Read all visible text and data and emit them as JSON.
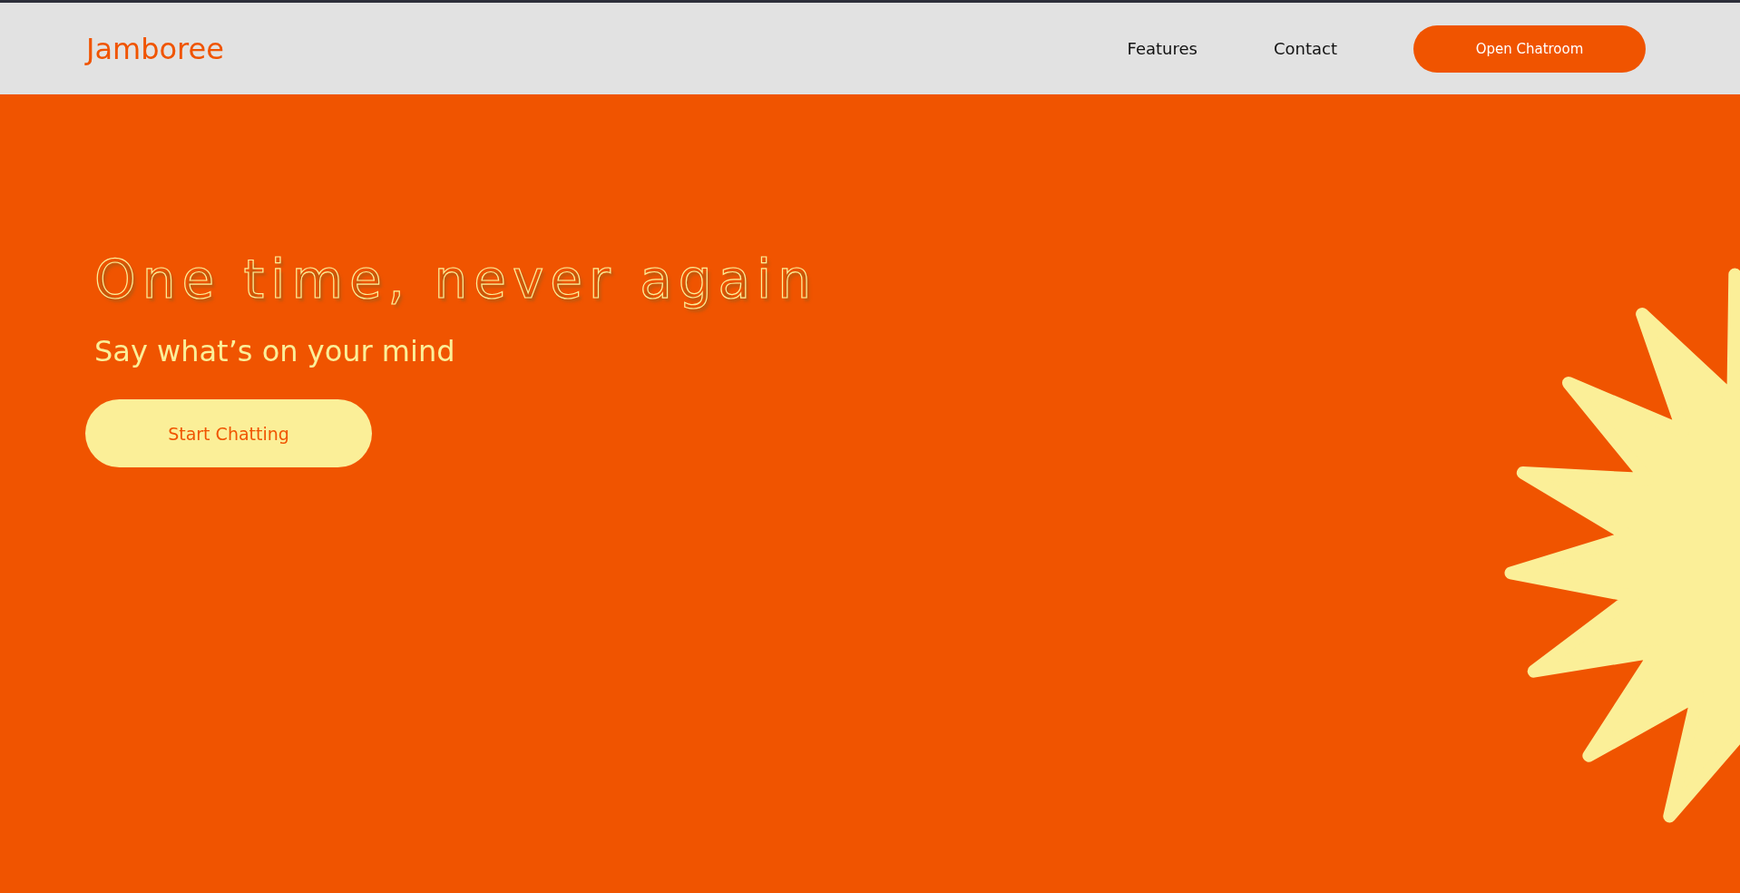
{
  "header": {
    "brand": "Jamboree",
    "nav": [
      {
        "label": "Features"
      },
      {
        "label": "Contact"
      }
    ],
    "cta": "Open Chatroom"
  },
  "hero": {
    "heading": "One time, never again",
    "subheading": "Say what’s on your mind",
    "button": "Start Chatting"
  }
}
